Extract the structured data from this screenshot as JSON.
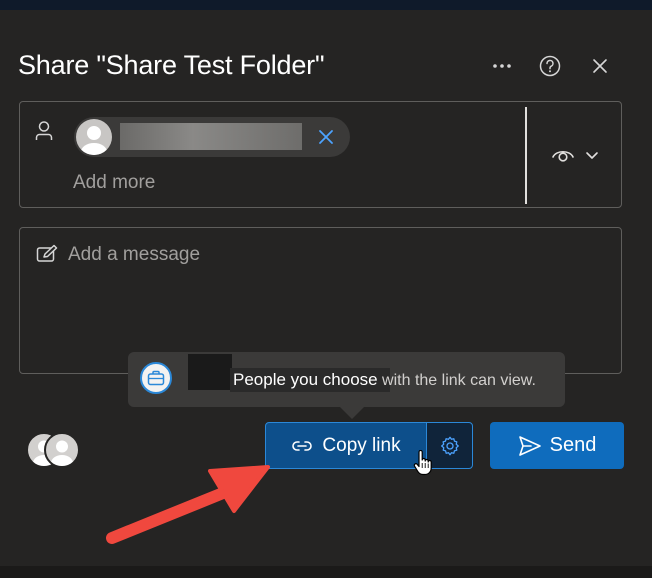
{
  "dialog": {
    "title": "Share \"Share Test Folder\"",
    "more_icon": "ellipsis-icon",
    "help_icon": "help-icon",
    "close_icon": "close-icon"
  },
  "recipients": {
    "person_icon": "person-icon",
    "chip_remove_icon": "close-icon",
    "add_more_placeholder": "Add more",
    "permission_icon": "eye-icon",
    "permission_dropdown_icon": "chevron-down-icon"
  },
  "message": {
    "icon": "edit-icon",
    "placeholder": "Add a message"
  },
  "tooltip": {
    "icon": "briefcase-icon",
    "text_main": "People you choose",
    "text_rest": " with the link can view."
  },
  "footer": {
    "copy_link_label": "Copy link",
    "copy_link_icon": "link-icon",
    "settings_icon": "gear-icon",
    "send_label": "Send",
    "send_icon": "send-icon"
  },
  "colors": {
    "accent": "#0f6cbd",
    "copy_bg": "#0d4f8b",
    "annotation_arrow": "#f0483e",
    "background": "#252423"
  }
}
